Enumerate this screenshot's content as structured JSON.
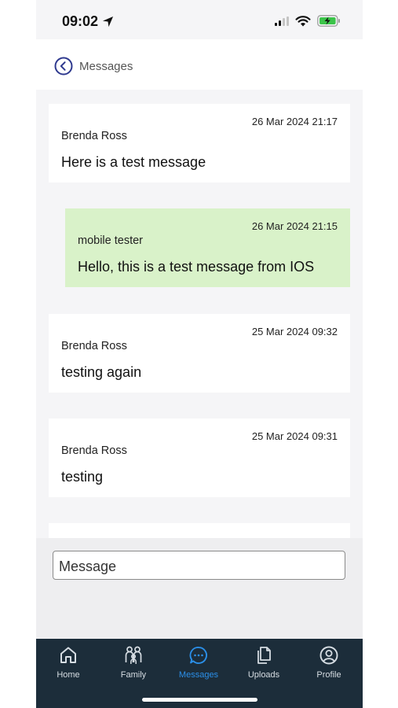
{
  "status_bar": {
    "time": "09:02"
  },
  "header": {
    "title": "Messages"
  },
  "messages": [
    {
      "date": "26 Mar 2024 21:17",
      "author": "Brenda Ross",
      "text": "Here is a test message",
      "mine": false
    },
    {
      "date": "26 Mar 2024 21:15",
      "author": "mobile tester",
      "text": "Hello, this is a test message from IOS",
      "mine": true
    },
    {
      "date": "25 Mar 2024 09:32",
      "author": "Brenda Ross",
      "text": "testing again",
      "mine": false
    },
    {
      "date": "25 Mar 2024 09:31",
      "author": "Brenda Ross",
      "text": "testing",
      "mine": false
    }
  ],
  "composer": {
    "placeholder": "Message",
    "value": ""
  },
  "tabbar": {
    "active_color": "#2b8fe8",
    "background_color": "#1c2d3a",
    "items": [
      {
        "label": "Home",
        "icon": "home-icon"
      },
      {
        "label": "Family",
        "icon": "family-icon"
      },
      {
        "label": "Messages",
        "icon": "messages-icon",
        "active": true
      },
      {
        "label": "Uploads",
        "icon": "uploads-icon"
      },
      {
        "label": "Profile",
        "icon": "profile-icon"
      }
    ]
  },
  "colors": {
    "own_message_bg": "#d9f2c9",
    "other_message_bg": "#ffffff"
  }
}
